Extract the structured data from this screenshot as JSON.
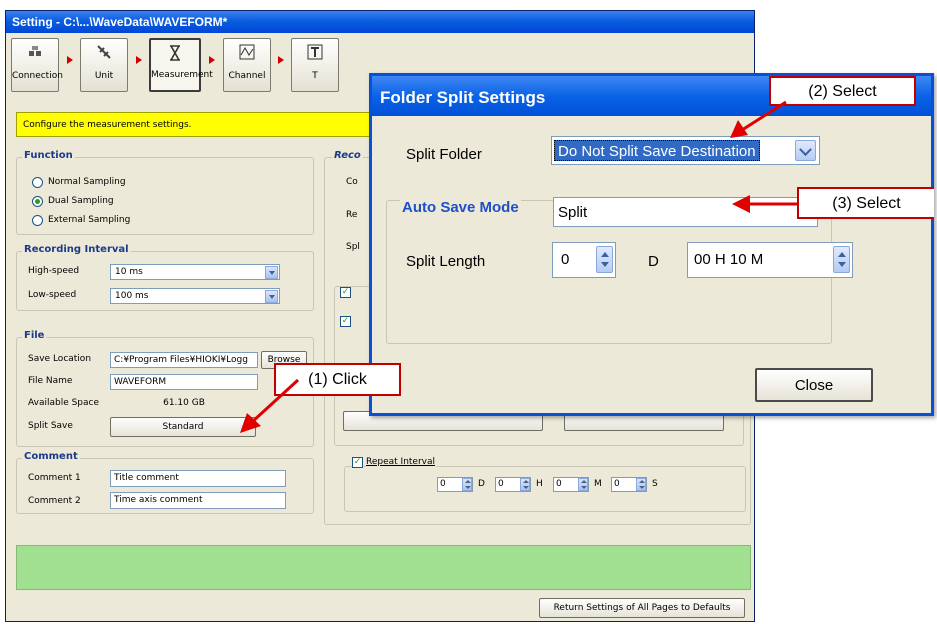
{
  "window": {
    "title": "Setting - C:\\...\\WaveData\\WAVEFORM*",
    "toolbar": [
      {
        "label": "Connection",
        "icon": "connection-icon"
      },
      {
        "label": "Unit",
        "icon": "unit-icon"
      },
      {
        "label": "Measurement",
        "icon": "hourglass-icon"
      },
      {
        "label": "Channel",
        "icon": "channel-icon"
      },
      {
        "label": "T",
        "icon": "trigger-icon"
      },
      {
        "label": "",
        "icon": "speaker-icon"
      },
      {
        "label": "",
        "icon": "tool-icon"
      },
      {
        "label": "",
        "icon": "export-icon"
      },
      {
        "label": "",
        "icon": "exit-icon"
      }
    ],
    "hint": "Configure the measurement settings."
  },
  "function": {
    "title": "Function",
    "options": [
      "Normal Sampling",
      "Dual Sampling",
      "External Sampling"
    ],
    "selected": "Dual Sampling"
  },
  "recording_interval": {
    "title": "Recording Interval",
    "high_label": "High-speed",
    "high_value": "10 ms",
    "low_label": "Low-speed",
    "low_value": "100 ms"
  },
  "file": {
    "title": "File",
    "save_location_label": "Save Location",
    "save_location_value": "C:¥Program Files¥HIOKI¥Logg",
    "browse_label": "Browse",
    "file_name_label": "File Name",
    "file_name_value": "WAVEFORM",
    "space_label": "Available Space",
    "space_value": "61.10 GB",
    "split_label": "Split Save",
    "split_value": "Standard"
  },
  "comment": {
    "title": "Comment",
    "c1_label": "Comment 1",
    "c1_value": "Title comment",
    "c2_label": "Comment 2",
    "c2_value": "Time axis comment"
  },
  "record": {
    "title": "Reco",
    "row1": "Co",
    "row2": "Re",
    "row3": "Spl"
  },
  "repeat": {
    "label": "Repeat Interval",
    "d_value": "0",
    "d_unit": "D",
    "h_value": "0",
    "h_unit": "H",
    "m_value": "0",
    "m_unit": "M",
    "s_value": "0",
    "s_unit": "S"
  },
  "footer": {
    "defaults_button": "Return Settings of All Pages to Defaults"
  },
  "dialog": {
    "title": "Folder Split Settings",
    "split_folder_label": "Split Folder",
    "split_folder_value": "Do Not Split Save Destination",
    "auto_save_title": "Auto Save Mode",
    "auto_save_value": "Split",
    "split_length_label": "Split Length",
    "split_length_value": "0",
    "split_length_unit": "D",
    "split_time_value": "00 H 10 M",
    "close_label": "Close"
  },
  "callouts": {
    "c1": "(1) Click",
    "c2": "(2) Select",
    "c3": "(3) Select"
  },
  "colors": {
    "titlebar": "#0a5ee0",
    "hint_bg": "#ffff00",
    "status_bg": "#a0e090",
    "callout_border": "#c00000",
    "group_title": "#1c3a8a"
  }
}
